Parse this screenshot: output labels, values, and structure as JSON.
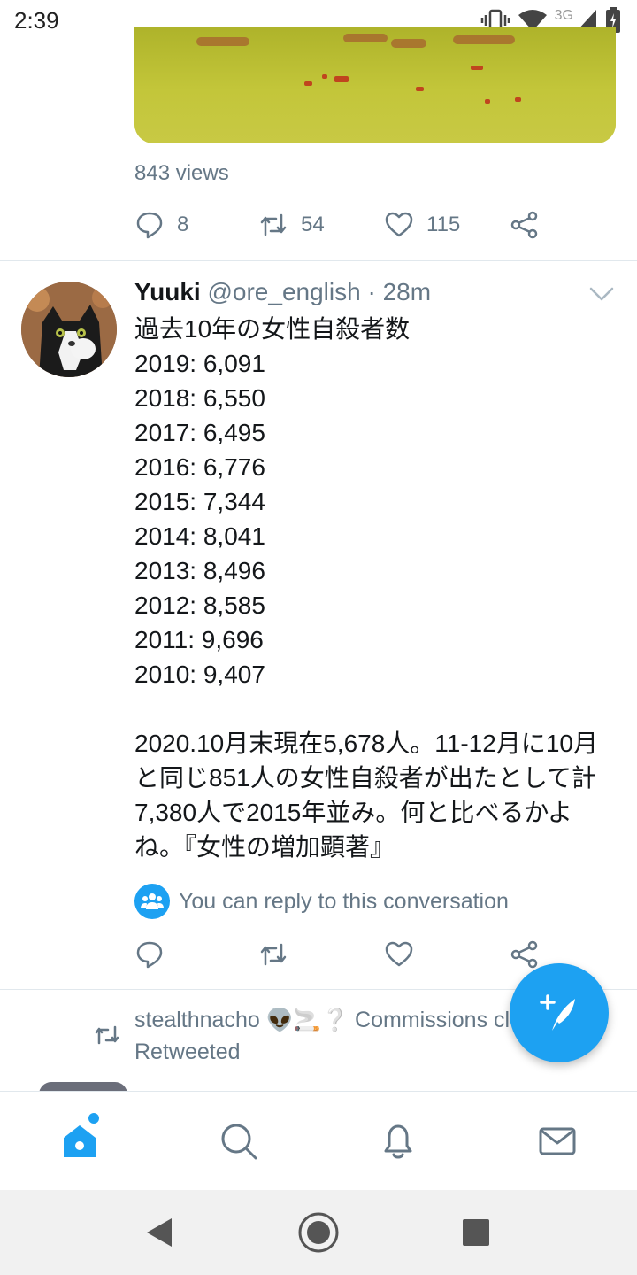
{
  "status_bar": {
    "time": "2:39",
    "network": "3G"
  },
  "prev_tweet": {
    "views": "843 views",
    "reply_count": "8",
    "retweet_count": "54",
    "like_count": "115"
  },
  "tweet": {
    "name": "Yuuki",
    "handle": "@ore_english",
    "separator": "·",
    "time": "28m",
    "text": "過去10年の女性自殺者数\n2019: 6,091\n2018: 6,550\n2017: 6,495\n2016: 6,776\n2015: 7,344\n2014: 8,041\n2013: 8,496\n2012: 8,585\n2011: 9,696\n2010: 9,407\n\n2020.10月末現在5,678人。11-12月に10月と同じ851人の女性自殺者が出たとして計7,380人で2015年並み。何と比べるかよね。『女性の増加顕著』",
    "reply_note": "You can reply to this conversation"
  },
  "retweet_context": {
    "user": "stealthnacho 👽🚬❔ Commissions clo",
    "label": "Retweeted"
  },
  "colors": {
    "accent": "#1da1f2",
    "muted": "#657786",
    "text": "#14171a"
  },
  "icons": [
    "reply-icon",
    "retweet-icon",
    "like-icon",
    "share-icon",
    "compose-icon",
    "home-icon",
    "search-icon",
    "notifications-icon",
    "messages-icon"
  ]
}
